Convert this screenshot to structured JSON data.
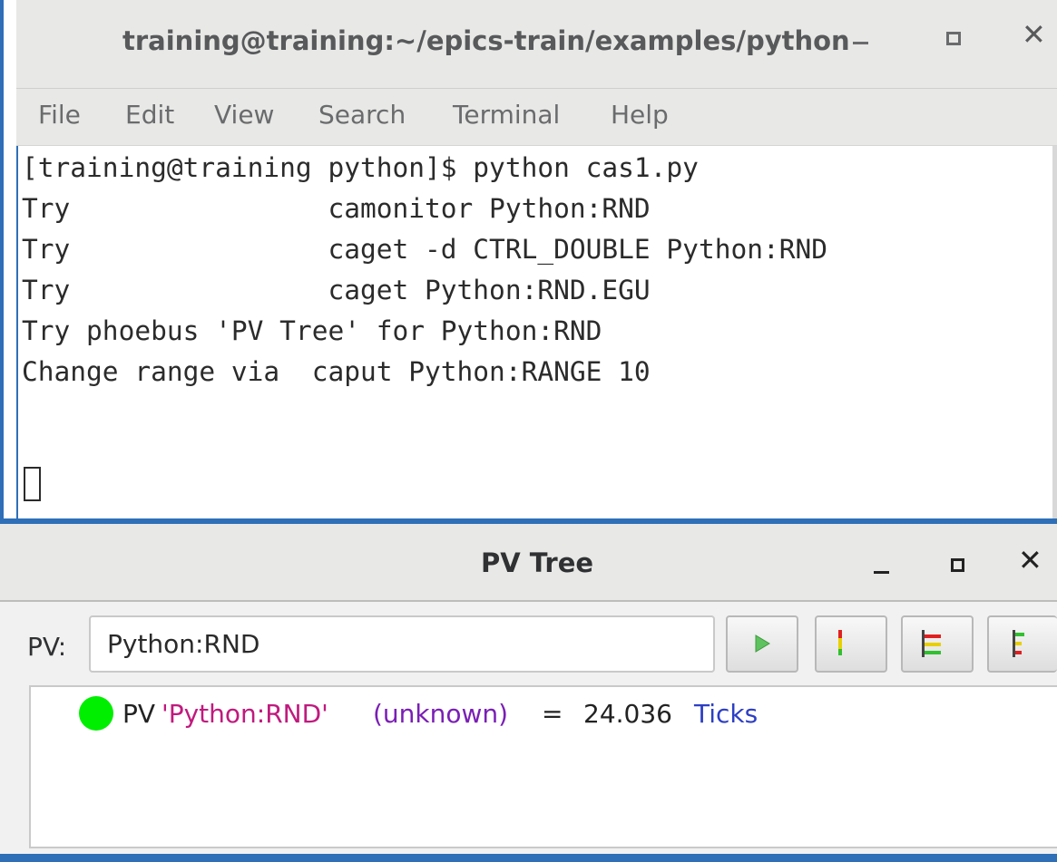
{
  "terminal": {
    "title": "training@training:~/epics-train/examples/python",
    "menu": [
      "File",
      "Edit",
      "View",
      "Search",
      "Terminal",
      "Help"
    ],
    "lines": [
      "[training@training python]$ python cas1.py",
      "Try                camonitor Python:RND",
      "Try                caget -d CTRL_DOUBLE Python:RND",
      "Try                caget Python:RND.EGU",
      "Try phoebus 'PV Tree' for Python:RND",
      "Change range via  caput Python:RANGE 10"
    ]
  },
  "pv_tree": {
    "title": "PV Tree",
    "pv_label": "PV:",
    "pv_value": "Python:RND",
    "buttons": [
      "play",
      "alarm",
      "collapse",
      "expand"
    ],
    "entry": {
      "prefix": "PV ",
      "name": "'Python:RND'",
      "type": "(unknown)",
      "eq": "=",
      "value": "24.036",
      "units": "Ticks",
      "status_color": "#00ee00"
    }
  },
  "colors": {
    "accent": "#2e6fb8",
    "pv_name": "#c01a7e",
    "pv_type": "#7a1fb5",
    "units": "#2d3fc4"
  }
}
